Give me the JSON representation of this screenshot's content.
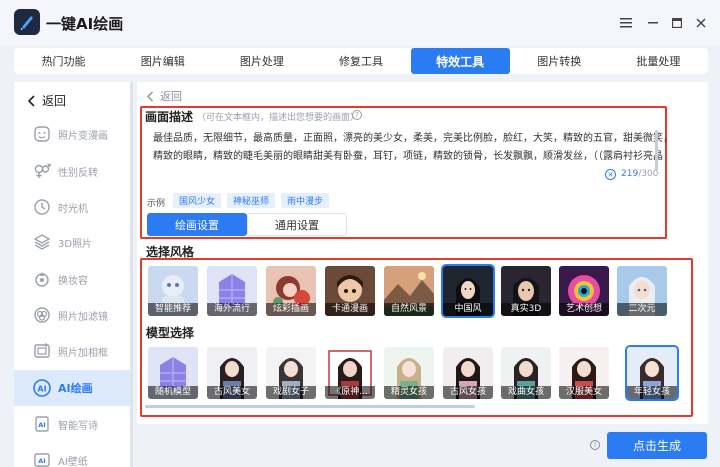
{
  "app": {
    "title": "一键AI绘画"
  },
  "window": {
    "menu_icon": "menu-icon",
    "minimize_icon": "minimize-icon",
    "maximize_icon": "maximize-icon",
    "close_icon": "close-icon"
  },
  "tabs": [
    {
      "label": "热门功能"
    },
    {
      "label": "图片编辑"
    },
    {
      "label": "图片处理"
    },
    {
      "label": "修复工具"
    },
    {
      "label": "特效工具",
      "active": true
    },
    {
      "label": "图片转换"
    },
    {
      "label": "批量处理"
    }
  ],
  "sidebar": {
    "back_label": "返回",
    "items": [
      {
        "label": "照片变漫画",
        "icon": "cartoon-face-icon"
      },
      {
        "label": "性别反转",
        "icon": "gender-icon"
      },
      {
        "label": "时光机",
        "icon": "clock-icon"
      },
      {
        "label": "3D照片",
        "icon": "layers-icon"
      },
      {
        "label": "换妆容",
        "icon": "makeup-icon"
      },
      {
        "label": "照片加滤镜",
        "icon": "filter-icon"
      },
      {
        "label": "照片加相框",
        "icon": "frame-icon"
      },
      {
        "label": "AI绘画",
        "icon": "ai-paint-icon",
        "active": true
      },
      {
        "label": "智能写诗",
        "icon": "ai-poem-icon"
      },
      {
        "label": "AI壁纸",
        "icon": "ai-wallpaper-icon"
      }
    ]
  },
  "main": {
    "back_label": "返回",
    "desc_title": "画面描述",
    "desc_hint": "（可在文本框内，描述出您想要的画面）",
    "desc_text": "最佳品质，无限细节，最高质量，正面照，漂亮的美少女，柔美，完美比例脸，脸红，大笑，精致的五官，甜美微笑，精致的眼睛，精致的睫毛美丽的眼睛甜美有卧蚕，耳钉，项链，精致的锁骨，长发飘飘，顺滑发丝，（（露肩衬衫亮晶晶，花边衬",
    "char_count": "219",
    "char_max": "/300",
    "example_label": "示例",
    "examples": [
      "国风少女",
      "神秘巫师",
      "雨中漫步"
    ],
    "setting_tabs": [
      "绘画设置",
      "通用设置"
    ],
    "style_title": "选择风格",
    "styles": [
      "智能推荐",
      "海外流行",
      "炫彩插画",
      "卡通漫画",
      "自然风景",
      "中国风",
      "真实3D",
      "艺术创想",
      "二次元"
    ],
    "model_title": "模型选择",
    "models": [
      "随机模型",
      "古风美女",
      "戏剧女子",
      "《原神...",
      "精灵女孩",
      "古风女孩",
      "戏曲女孩",
      "汉服美女",
      "年轻女孩"
    ]
  },
  "generate_label": "点击生成",
  "colors": {
    "accent": "#2b7bf2",
    "highlight_border": "#e53a2b"
  }
}
